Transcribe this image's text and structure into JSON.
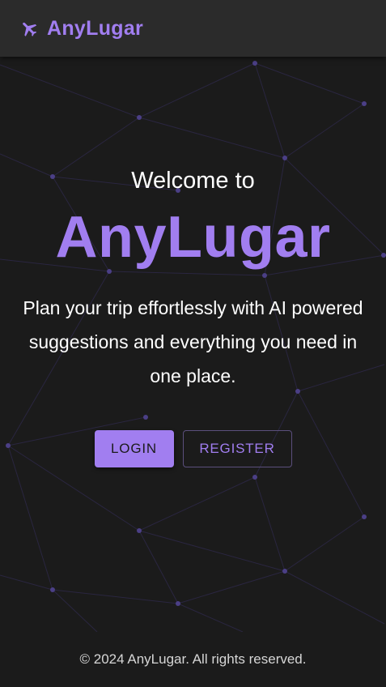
{
  "colors": {
    "accent": "#a17ef0",
    "background": "#1b1b1b",
    "header": "#2b2b2b",
    "text": "#ffffff",
    "footer_text": "#d6d6d6"
  },
  "header": {
    "logo_icon": "airplane-icon",
    "brand": "AnyLugar"
  },
  "hero": {
    "welcome": "Welcome to",
    "title": "AnyLugar",
    "tagline": "Plan your trip effortlessly with AI powered suggestions and everything you need in one place."
  },
  "actions": {
    "login_label": "LOGIN",
    "register_label": "REGISTER"
  },
  "footer": {
    "text": "© 2024 AnyLugar. All rights reserved."
  }
}
